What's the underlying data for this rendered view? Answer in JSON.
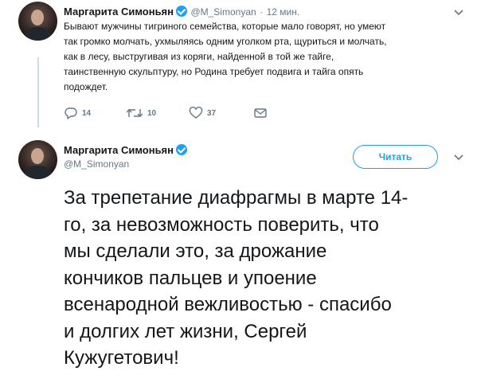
{
  "tweet1": {
    "author_name": "Маргарита Симоньян",
    "handle": "@M_Simonyan",
    "separator": "·",
    "time": "12 мин.",
    "text_lines": [
      "Бывают мужчины тигриного семейства, которые мало говорят,  но умеют",
      "так громко молчать, ухмыляясь одним уголком рта, щуриться и молчать,",
      "как в лесу, выстругивая из коряги, найденной в той же тайге,",
      "таинственную скульптуру, но Родина требует подвига и тайга опять",
      "подождет."
    ],
    "actions": {
      "reply_count": "14",
      "retweet_count": "10",
      "like_count": "37"
    }
  },
  "tweet2": {
    "author_name": "Маргарита Симоньян",
    "handle": "@M_Simonyan",
    "follow_label": "Читать",
    "text_lines": [
      "За трепетание диафрагмы в марте 14-",
      "го, за невозможность поверить, что",
      "мы сделали это, за дрожание",
      "кончиков пальцев и упоение",
      "всенародной вежливостью - спасибо",
      "и долгих лет жизни, Сергей",
      "Кужугетович!"
    ]
  },
  "icons": {
    "verified": "verified-badge-icon",
    "reply": "reply-icon",
    "retweet": "retweet-icon",
    "like": "heart-icon",
    "dm": "envelope-icon",
    "menu": "chevron-down-icon"
  },
  "colors": {
    "accent": "#1da1f2",
    "text": "#14171a",
    "muted": "#657786",
    "thread_line": "#cfd9de"
  }
}
